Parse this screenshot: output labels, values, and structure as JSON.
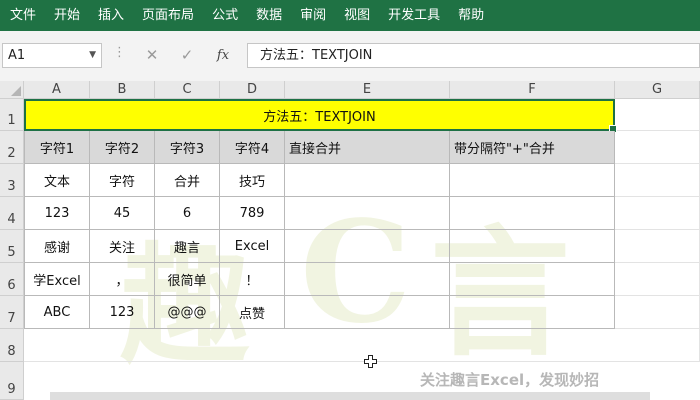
{
  "menu": {
    "items": [
      "文件",
      "开始",
      "插入",
      "页面布局",
      "公式",
      "数据",
      "审阅",
      "视图",
      "开发工具",
      "帮助"
    ]
  },
  "formula_bar": {
    "name_box": "A1",
    "cancel_icon": "✕",
    "enter_icon": "✓",
    "fx_label": "fx",
    "formula": "方法五：TEXTJOIN"
  },
  "columns": [
    "A",
    "B",
    "C",
    "D",
    "E",
    "F",
    "G"
  ],
  "rows": [
    "1",
    "2",
    "3",
    "4",
    "5",
    "6",
    "7",
    "8",
    "9"
  ],
  "sheet": {
    "title": "方法五：TEXTJOIN",
    "headers": [
      "字符1",
      "字符2",
      "字符3",
      "字符4",
      "直接合并",
      "带分隔符\"+\"合并"
    ],
    "data": [
      [
        "文本",
        "字符",
        "合并",
        "技巧",
        "",
        ""
      ],
      [
        "123",
        "45",
        "6",
        "789",
        "",
        ""
      ],
      [
        "感谢",
        "关注",
        "趣言",
        "Excel",
        "",
        ""
      ],
      [
        "学Excel",
        "，",
        "很简单",
        "！",
        "",
        ""
      ],
      [
        "ABC",
        "123",
        "@@@",
        "点赞",
        "",
        ""
      ]
    ]
  },
  "footer": {
    "note": "关注趣言Excel，发现妙招"
  },
  "colors": {
    "ribbon": "#1f7244",
    "title_fill": "#ffff00",
    "header_fill": "#d9d9d9",
    "selection": "#1e7145"
  }
}
